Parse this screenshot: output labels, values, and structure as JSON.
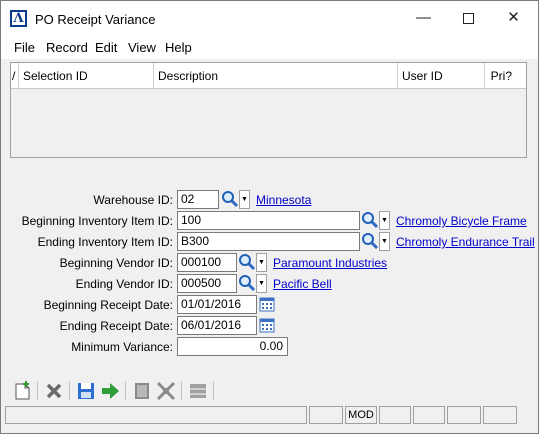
{
  "window": {
    "title": "PO Receipt Variance",
    "minimize_glyph": "—",
    "close_glyph": "✕"
  },
  "menu": {
    "items": [
      "File",
      "Record",
      "Edit",
      "View",
      "Help"
    ]
  },
  "grid": {
    "columns": [
      "/",
      "Selection ID",
      "Description",
      "User ID",
      "Pri?"
    ]
  },
  "form": {
    "warehouse": {
      "label": "Warehouse ID:",
      "value": "02",
      "link": "Minnesota"
    },
    "begin_item": {
      "label": "Beginning Inventory Item ID:",
      "value": "100",
      "link": "Chromoly Bicycle Frame"
    },
    "end_item": {
      "label": "Ending Inventory Item ID:",
      "value": "B300",
      "link": "Chromoly Endurance Trail"
    },
    "begin_vendor": {
      "label": "Beginning Vendor ID:",
      "value": "000100",
      "link": "Paramount Industries"
    },
    "end_vendor": {
      "label": "Ending Vendor ID:",
      "value": "000500",
      "link": "Pacific Bell"
    },
    "begin_date": {
      "label": "Beginning Receipt Date:",
      "value": "01/01/2016"
    },
    "end_date": {
      "label": "Ending Receipt Date:",
      "value": "06/01/2016"
    },
    "min_variance": {
      "label": "Minimum Variance:",
      "value": "0.00"
    }
  },
  "toolbar": {
    "icons": [
      "new-icon",
      "delete-icon",
      "save-icon",
      "run-icon",
      "grid-icon",
      "merge-icon",
      "disabled-icon"
    ]
  },
  "status": {
    "mode": "MOD"
  },
  "colors": {
    "link": "#0000cc",
    "accent": "#0d3b8c"
  }
}
